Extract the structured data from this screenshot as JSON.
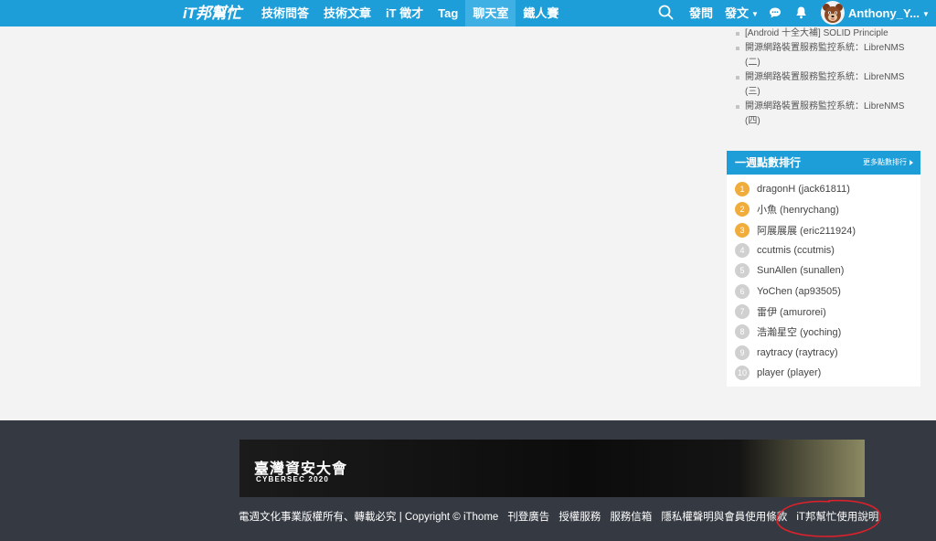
{
  "header": {
    "logo": "iT邦幫忙",
    "nav": [
      "技術問答",
      "技術文章",
      "iT 徵才",
      "Tag",
      "聊天室",
      "鐵人賽"
    ],
    "active_nav": "聊天室",
    "ask": "發問",
    "post": "發文",
    "username": "Anthony_Y..."
  },
  "sidebar": {
    "articles": [
      "[Android 十全大補] SOLID Principle",
      "開源網路裝置服務監控系統：LibreNMS (二)",
      "開源網路裝置服務監控系統：LibreNMS (三)",
      "開源網路裝置服務監控系統：LibreNMS (四)"
    ],
    "ranking": {
      "title": "一週點數排行",
      "more": "更多點數排行",
      "items": [
        {
          "rank": "1",
          "name": "dragonH (jack61811)"
        },
        {
          "rank": "2",
          "name": "小魚 (henrychang)"
        },
        {
          "rank": "3",
          "name": "阿展展展 (eric211924)"
        },
        {
          "rank": "4",
          "name": "ccutmis (ccutmis)"
        },
        {
          "rank": "5",
          "name": "SunAllen (sunallen)"
        },
        {
          "rank": "6",
          "name": "YoChen (ap93505)"
        },
        {
          "rank": "7",
          "name": "雷伊 (amurorei)"
        },
        {
          "rank": "8",
          "name": "浩瀚星空 (yoching)"
        },
        {
          "rank": "9",
          "name": "raytracy (raytracy)"
        },
        {
          "rank": "10",
          "name": "player (player)"
        }
      ]
    }
  },
  "footer": {
    "banner_title": "臺灣資安大會",
    "banner_subtitle": "CYBERSEC 2020",
    "copyright": "電週文化事業版權所有、轉載必究 | Copyright © iThome",
    "links": [
      "刊登廣告",
      "授權服務",
      "服務信箱",
      "隱私權聲明與會員使用條款",
      "iT邦幫忙使用說明"
    ]
  },
  "colors": {
    "accent": "#1e9ed8",
    "footer_bg": "#353a42",
    "rank_top": "#f1ad3c",
    "annotation": "#e0202a"
  }
}
